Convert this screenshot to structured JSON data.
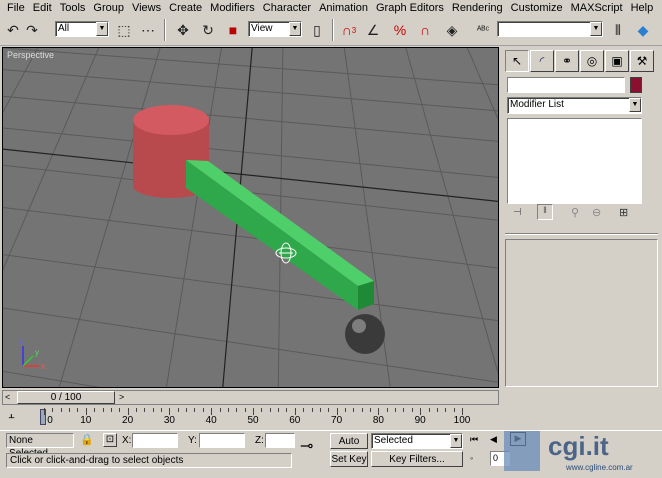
{
  "menu": [
    "File",
    "Edit",
    "Tools",
    "Group",
    "Views",
    "Create",
    "Modifiers",
    "Character",
    "Animation",
    "Graph Editors",
    "Rendering",
    "Customize",
    "MAXScript",
    "Help"
  ],
  "toolbar": {
    "selection_filter": "All",
    "ref_coord": "View",
    "snap_label": "3"
  },
  "viewport": {
    "label": "Perspective",
    "axis_x": "x",
    "axis_y": "y",
    "axis_z": "z"
  },
  "command_panel": {
    "name_color": "#8b0f2e",
    "modifier_list": "Modifier List"
  },
  "time": {
    "slider_label": "0 / 100",
    "ticks": [
      "0",
      "10",
      "20",
      "30",
      "40",
      "50",
      "60",
      "70",
      "80",
      "90",
      "100"
    ]
  },
  "status": {
    "selection": "None Selected",
    "x_label": "X:",
    "y_label": "Y:",
    "z_label": "Z:",
    "x_value": "",
    "y_value": "",
    "z_value": "",
    "auto_key": "Auto Key",
    "set_key": "Set Key",
    "selected_option": "Selected",
    "key_filters": "Key Filters...",
    "prompt": "Click or click-and-drag to select objects",
    "frame": "0",
    "watermark": "cgi.it",
    "watermark_url": "www.cgline.com.ar"
  }
}
